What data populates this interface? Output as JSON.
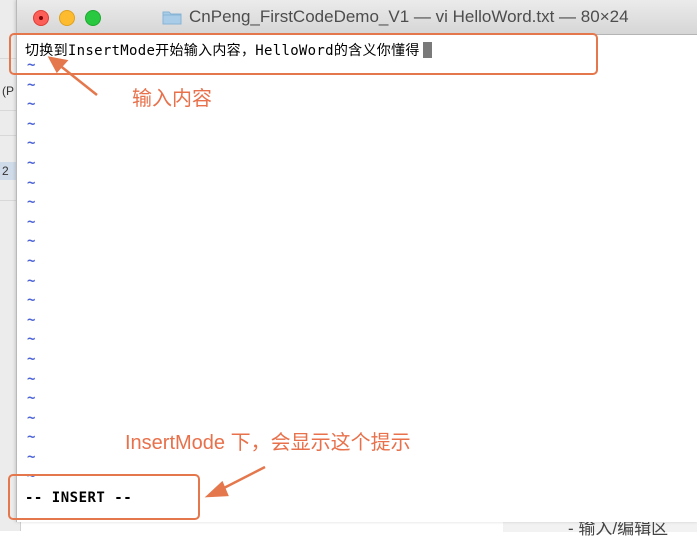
{
  "window": {
    "title": "CnPeng_FirstCodeDemo_V1 — vi HelloWord.txt — 80×24"
  },
  "editor": {
    "line1": "切换到InsertMode开始输入内容，HelloWord的含义你懂得",
    "tilde_char": "~",
    "tilde_count": 22,
    "mode_indicator": "-- INSERT --"
  },
  "annotations": {
    "input_note": "输入内容",
    "mode_note": "InsertMode 下，会显示这个提示"
  },
  "background": {
    "left_fragment_1": "(P",
    "left_fragment_2": "2",
    "bottom_fragment": "- 输入/编辑区"
  },
  "colors": {
    "annotation": "#e5774d",
    "tilde": "#4c63d6",
    "close": "#fc5f57",
    "minimize": "#fdbc2f",
    "maximize": "#28c840"
  }
}
